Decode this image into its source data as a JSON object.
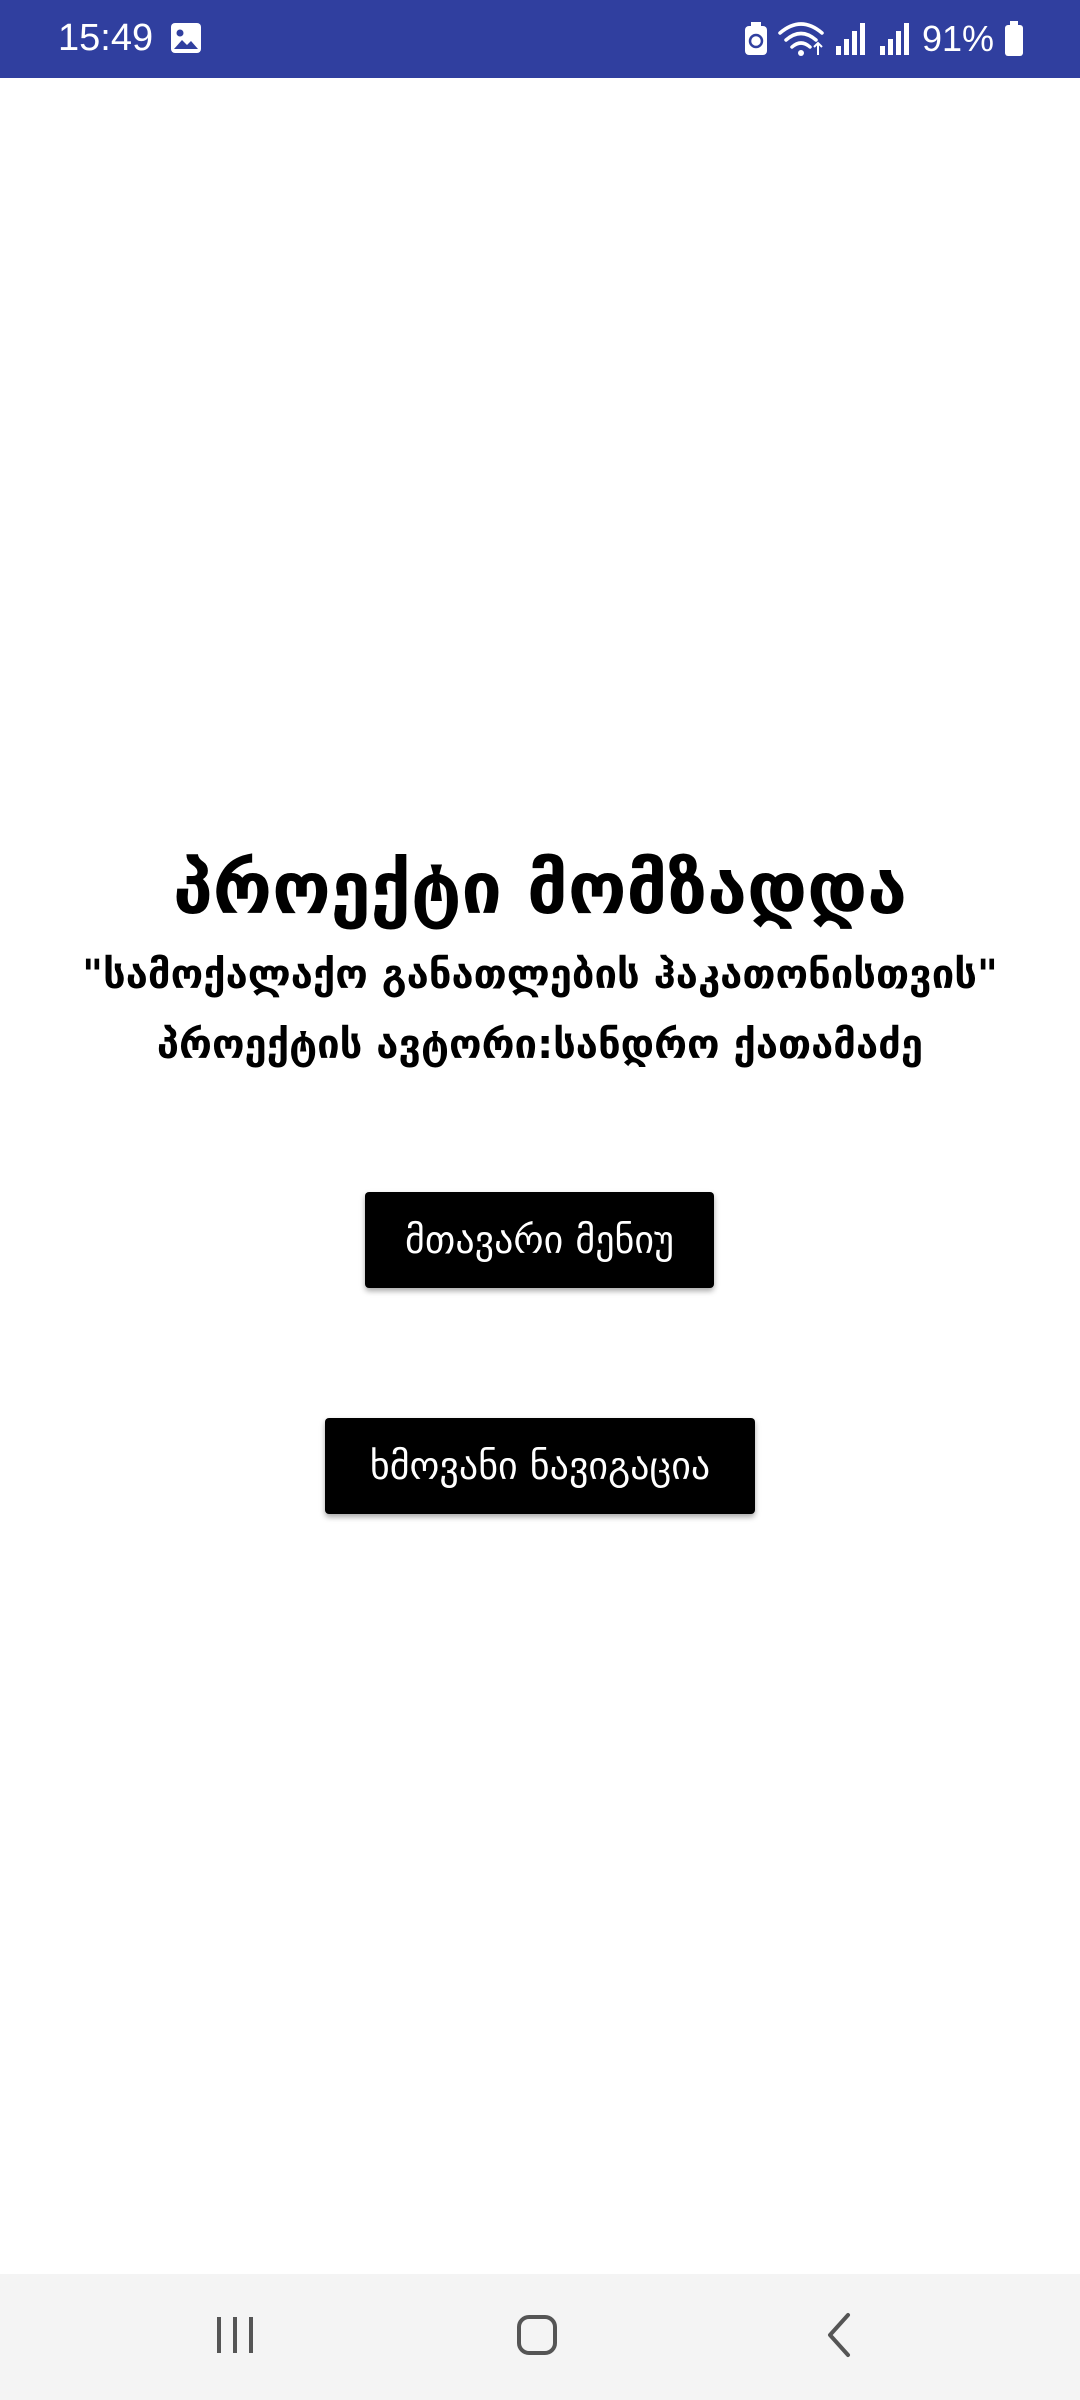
{
  "status_bar": {
    "time": "15:49",
    "battery": "91%",
    "background_color": "#303f9f",
    "icons": [
      "gallery-icon",
      "battery-saver-icon",
      "wifi-icon",
      "signal-icon",
      "signal-icon",
      "battery-icon"
    ]
  },
  "main": {
    "title": "პროექტი მომზადდა",
    "subtitle": "\"სამოქალაქო განათლების ჰაკათონისთვის\"",
    "author": "პროექტის ავტორი:სანდრო ქათამაძე",
    "buttons": {
      "main_menu": "მთავარი მენიუ",
      "voice_navigation": "ხმოვანი ნავიგაცია"
    },
    "button_color": "#000000"
  },
  "nav_bar": {
    "icons": [
      "recents-icon",
      "home-icon",
      "back-icon"
    ]
  }
}
